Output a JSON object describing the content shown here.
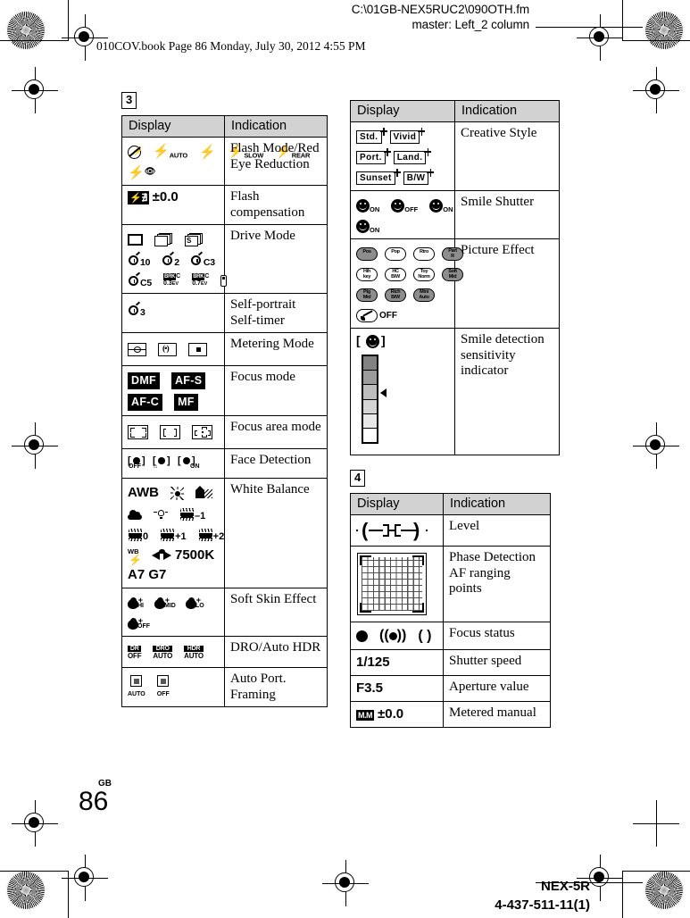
{
  "header": {
    "file_path": "C:\\01GB-NEX5RUC2\\090OTH.fm",
    "master_line": "master: Left_2 column",
    "book_line": "010COV.book  Page 86  Monday, July 30, 2012  4:55 PM"
  },
  "footer": {
    "locale": "GB",
    "page_number": "86",
    "model": "NEX-5R",
    "part_number": "4-437-511-11(1)"
  },
  "columns": {
    "left": {
      "section_number": "3",
      "table": {
        "headers": [
          "Display",
          "Indication"
        ],
        "rows": [
          {
            "indication": "Flash Mode/Red Eye Reduction",
            "icons": [
              "flash-off-icon",
              "flash-auto-icon",
              "flash-on-icon",
              "slow-sync-icon",
              "rear-sync-icon",
              "red-eye-reduction-icon"
            ],
            "labels": [
              "AUTO",
              "SLOW",
              "REAR"
            ]
          },
          {
            "indication": "Flash compensation",
            "icons": [
              "flash-compensation-icon"
            ],
            "value": "±0.0"
          },
          {
            "indication": "Drive Mode",
            "icons": [
              "single-shot-icon",
              "continuous-icon",
              "speed-priority-icon",
              "self-timer-10-icon",
              "self-timer-2-icon",
              "self-timer-c3-icon",
              "self-timer-c5-icon",
              "bracket-0.3ev-icon",
              "bracket-0.7ev-icon",
              "remote-commander-icon"
            ],
            "labels": [
              "10",
              "2",
              "C3",
              "C5",
              "0.3",
              "0.7",
              "EV",
              "C",
              "BRK",
              "S"
            ]
          },
          {
            "indication": "Self-portrait Self-timer",
            "icons": [
              "self-timer-3-icon"
            ],
            "labels": [
              "3"
            ]
          },
          {
            "indication": "Metering Mode",
            "icons": [
              "multi-metering-icon",
              "center-weighted-metering-icon",
              "spot-metering-icon"
            ]
          },
          {
            "indication": "Focus mode",
            "icons": [
              "dmf-icon",
              "af-s-icon",
              "af-c-icon",
              "mf-icon"
            ],
            "labels": [
              "DMF",
              "AF-S",
              "AF-C",
              "MF"
            ]
          },
          {
            "indication": "Focus area mode",
            "icons": [
              "multi-focus-area-icon",
              "center-focus-area-icon",
              "flexible-spot-icon"
            ]
          },
          {
            "indication": "Face Detection",
            "icons": [
              "face-detection-off-icon",
              "face-registration-icon",
              "face-detection-on-icon"
            ],
            "labels": [
              "OFF",
              "ON"
            ]
          },
          {
            "indication": "White Balance",
            "icons": [
              "awb-icon",
              "daylight-icon",
              "shade-icon",
              "cloudy-icon",
              "incandescent-icon",
              "fluorescent-warm-white-icon",
              "fluorescent-cool-white-icon",
              "fluorescent-day-white-icon",
              "fluorescent-daylight-icon",
              "flash-wb-icon",
              "custom-wb-icon"
            ],
            "labels": [
              "AWB",
              "-1",
              "0",
              "+1",
              "+2",
              "WB",
              "7500K",
              "A7 G7"
            ]
          },
          {
            "indication": "Soft Skin Effect",
            "icons": [
              "soft-skin-hi-icon",
              "soft-skin-mid-icon",
              "soft-skin-lo-icon",
              "soft-skin-off-icon"
            ],
            "labels": [
              "HI",
              "MID",
              "LO",
              "OFF"
            ]
          },
          {
            "indication": "DRO/Auto HDR",
            "icons": [
              "dro-off-icon",
              "dro-auto-icon",
              "hdr-auto-icon"
            ],
            "labels": [
              "OFF",
              "AUTO",
              "AUTO"
            ]
          },
          {
            "indication": "Auto Port. Framing",
            "icons": [
              "auto-portrait-framing-auto-icon",
              "auto-portrait-framing-off-icon"
            ],
            "labels": [
              "AUTO",
              "OFF"
            ]
          }
        ]
      }
    },
    "right": {
      "tables": [
        {
          "section_number": null,
          "headers": [
            "Display",
            "Indication"
          ],
          "rows": [
            {
              "indication": "Creative Style",
              "labels": [
                "Std.",
                "Vivid",
                "Port.",
                "Land.",
                "Sunset",
                "B/W"
              ]
            },
            {
              "indication": "Smile Shutter",
              "icons": [
                "smile-shutter-on-icon",
                "smile-shutter-off-icon",
                "smile-shutter-on-icon",
                "smile-shutter-on-icon"
              ],
              "labels": [
                "ON",
                "OFF",
                "ON",
                "ON"
              ]
            },
            {
              "indication": "Picture Effect",
              "labels": [
                "Posz",
                "Pop",
                "Rtro",
                "Part\nR",
                "Hih\nkey",
                "HC\nB/W",
                "Toy\nNorm",
                "Soft\nMid",
                "Rtrg\nMid",
                "Rich\nB/W",
                "Mini\nAuto",
                "OFF"
              ]
            },
            {
              "indication": "Smile detection sensitivity indicator",
              "icons": [
                "smile-detection-bracket-icon",
                "smile-sensitivity-bar"
              ]
            }
          ]
        },
        {
          "section_number": "4",
          "headers": [
            "Display",
            "Indication"
          ],
          "rows": [
            {
              "indication": "Level",
              "icons": [
                "level-icon"
              ]
            },
            {
              "indication": "Phase Detection AF ranging points",
              "icons": [
                "phase-detection-af-grid-icon"
              ]
            },
            {
              "indication": "Focus status",
              "icons": [
                "focus-locked-icon",
                "focus-tracking-icon",
                "focus-searching-icon"
              ]
            },
            {
              "indication": "Shutter speed",
              "value": "1/125"
            },
            {
              "indication": "Aperture value",
              "value": "F3.5"
            },
            {
              "indication": "Metered manual",
              "icons": [
                "metered-manual-icon"
              ],
              "value": "±0.0"
            }
          ]
        }
      ]
    }
  }
}
